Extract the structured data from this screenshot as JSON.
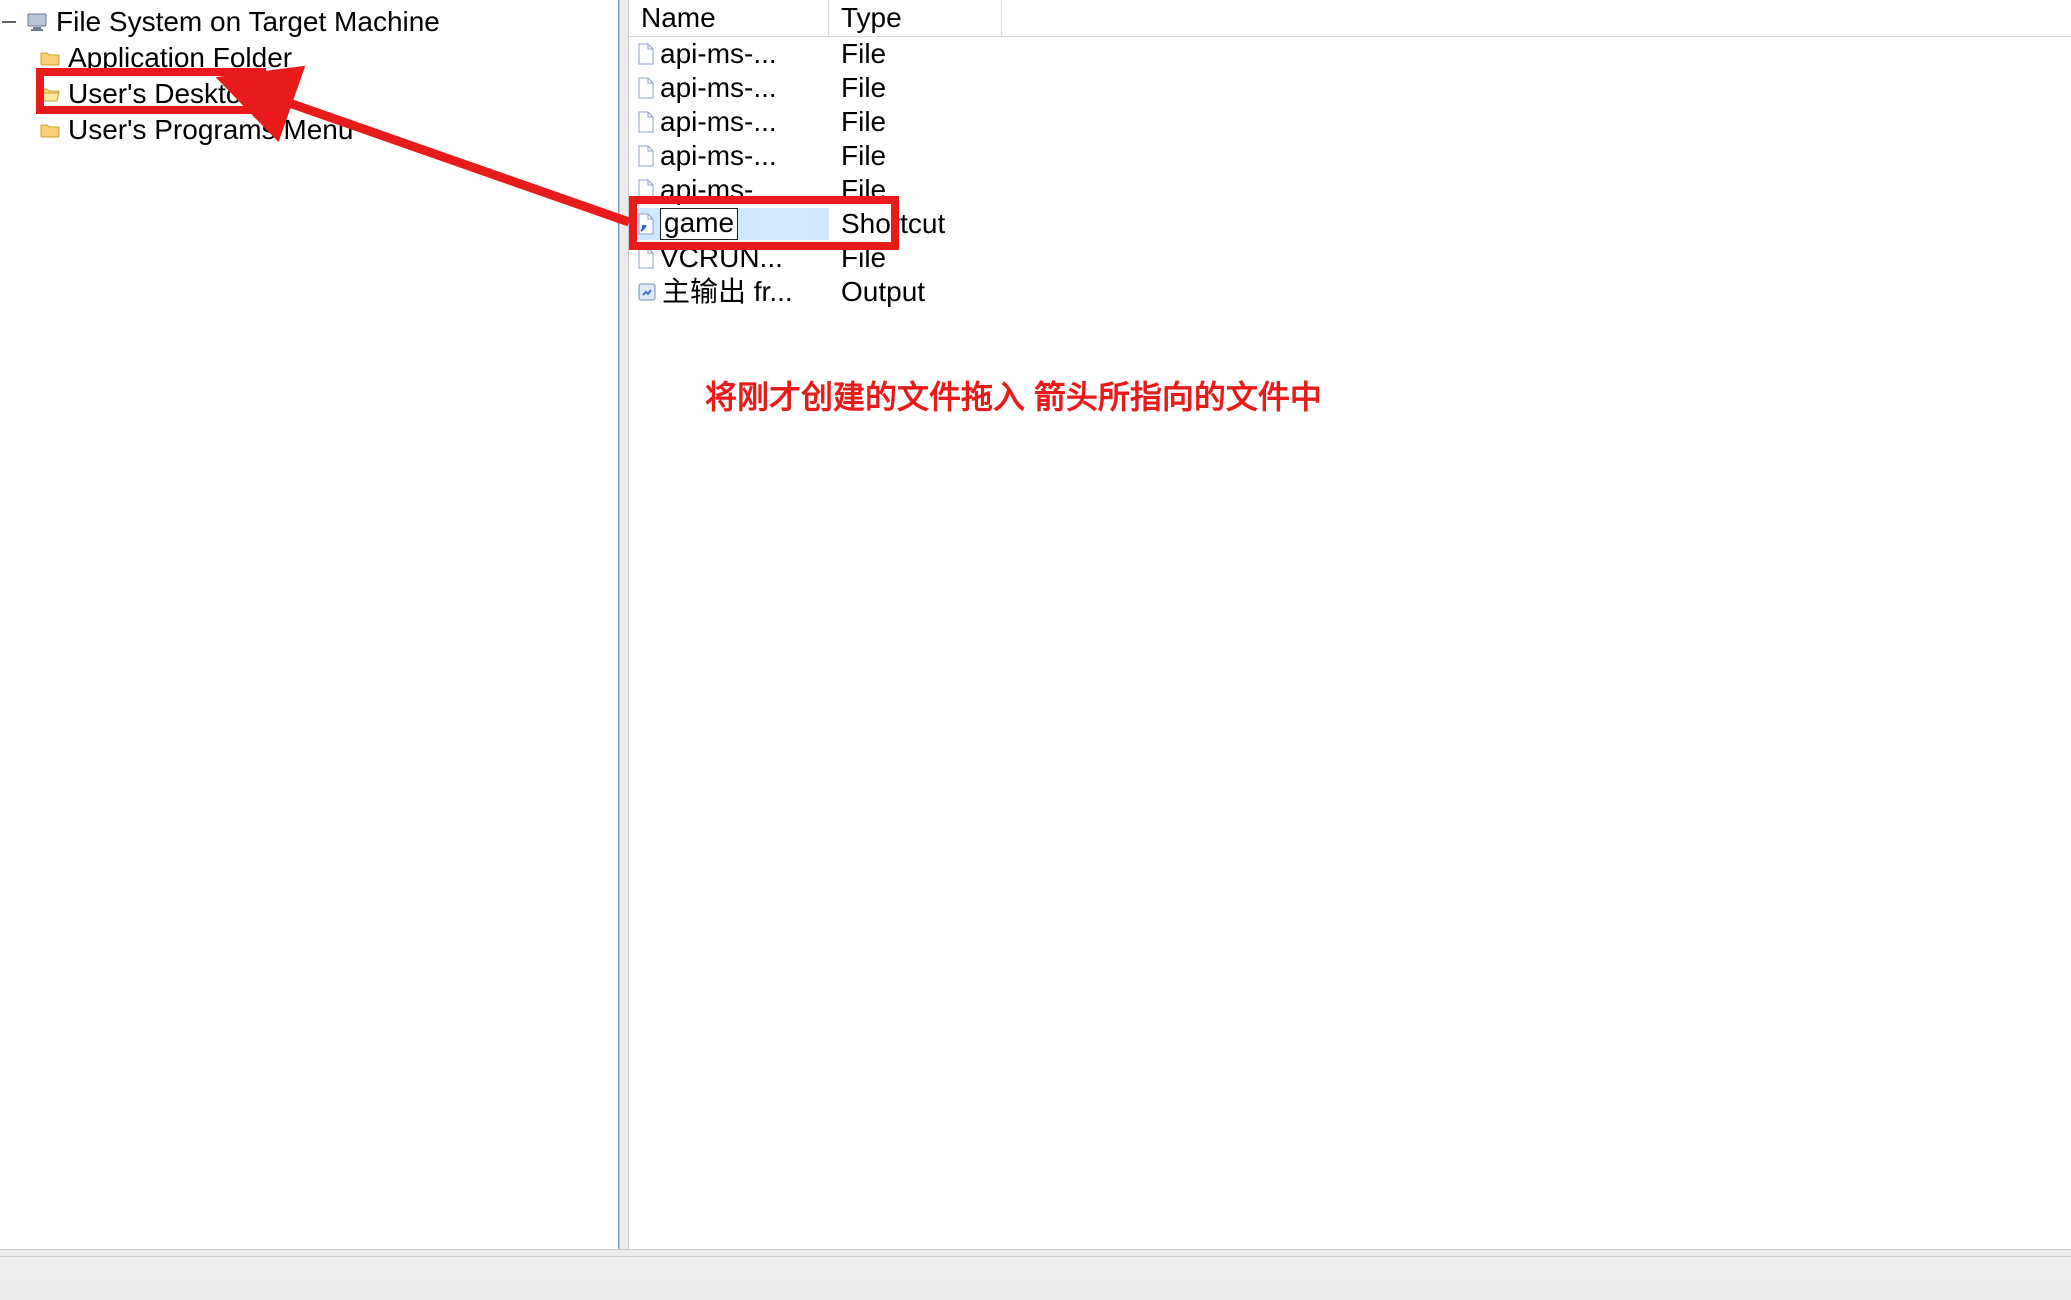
{
  "tree": {
    "root_label": "File System on Target Machine",
    "items": [
      {
        "label": "Application Folder",
        "selected": false
      },
      {
        "label": "User's Desktop",
        "selected": true
      },
      {
        "label": "User's Programs Menu",
        "selected": false
      }
    ]
  },
  "list": {
    "columns": {
      "name": "Name",
      "type": "Type"
    },
    "rows": [
      {
        "name": "api-ms-...",
        "type": "File",
        "icon": "file"
      },
      {
        "name": "api-ms-...",
        "type": "File",
        "icon": "file"
      },
      {
        "name": "api-ms-...",
        "type": "File",
        "icon": "file"
      },
      {
        "name": "api-ms-...",
        "type": "File",
        "icon": "file"
      },
      {
        "name": "api-ms-...",
        "type": "File",
        "icon": "file"
      },
      {
        "name": "game",
        "type": "Shortcut",
        "icon": "shortcut",
        "selected": true,
        "editing": true
      },
      {
        "name": "VCRUN...",
        "type": "File",
        "icon": "file"
      },
      {
        "name": "主输出 fr...",
        "type": "Output",
        "icon": "output"
      }
    ]
  },
  "annotation": {
    "text": "将刚才创建的文件拖入 箭头所指向的文件中",
    "color": "#e81b1b"
  }
}
